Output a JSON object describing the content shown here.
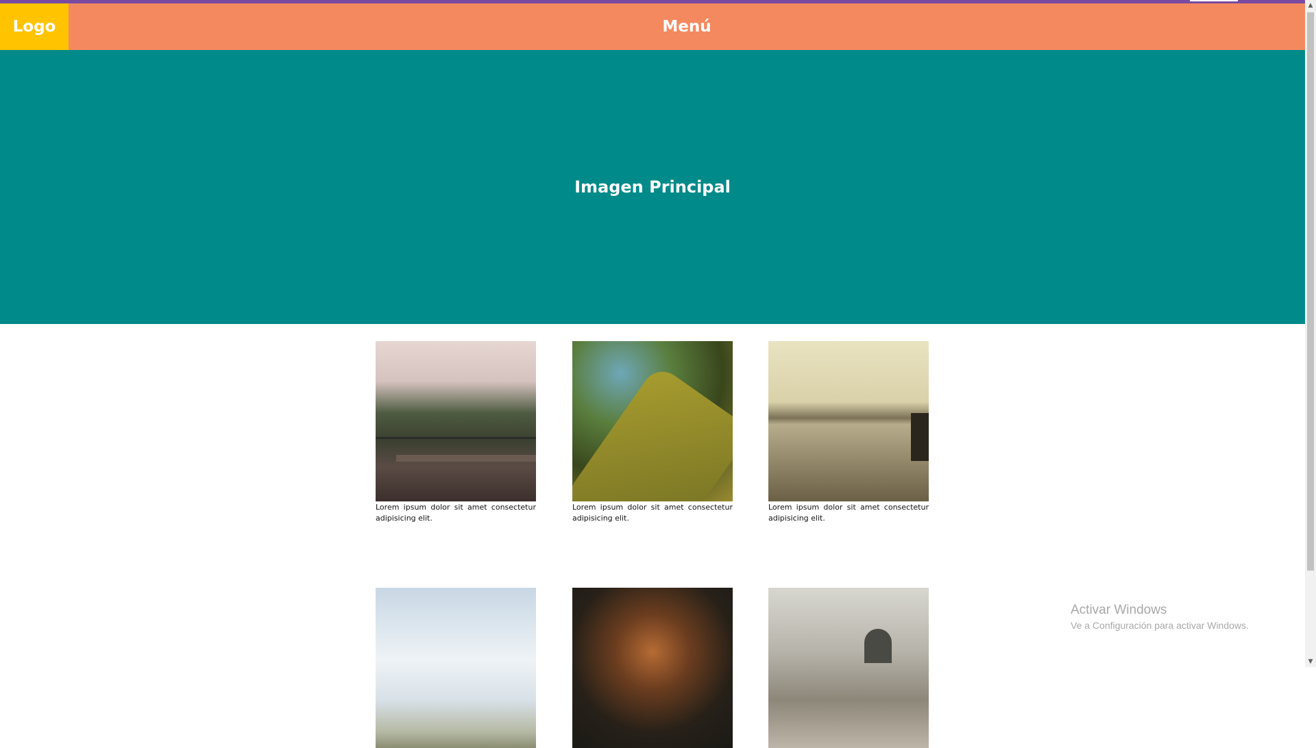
{
  "header": {
    "logo": "Logo",
    "menu": "Menú"
  },
  "hero": {
    "title": "Imagen Principal"
  },
  "gallery": {
    "items": [
      {
        "caption": "Lorem ipsum dolor sit amet consectetur adipisicing elit.",
        "image": "foggy-forest-bench"
      },
      {
        "caption": "Lorem ipsum dolor sit amet consectetur adipisicing elit.",
        "image": "mossy-tree-trunk"
      },
      {
        "caption": "Lorem ipsum dolor sit amet consectetur adipisicing elit.",
        "image": "river-city-ship"
      },
      {
        "caption": "",
        "image": "field-sky"
      },
      {
        "caption": "",
        "image": "tiger-cub"
      },
      {
        "caption": "",
        "image": "cathedral-dome"
      }
    ]
  },
  "watermark": {
    "title": "Activar Windows",
    "subtitle": "Ve a Configuración para activar Windows."
  },
  "colors": {
    "header": "#f4895f",
    "logo": "#ffc300",
    "hero": "#008a89",
    "topline": "#7a4aa0"
  }
}
